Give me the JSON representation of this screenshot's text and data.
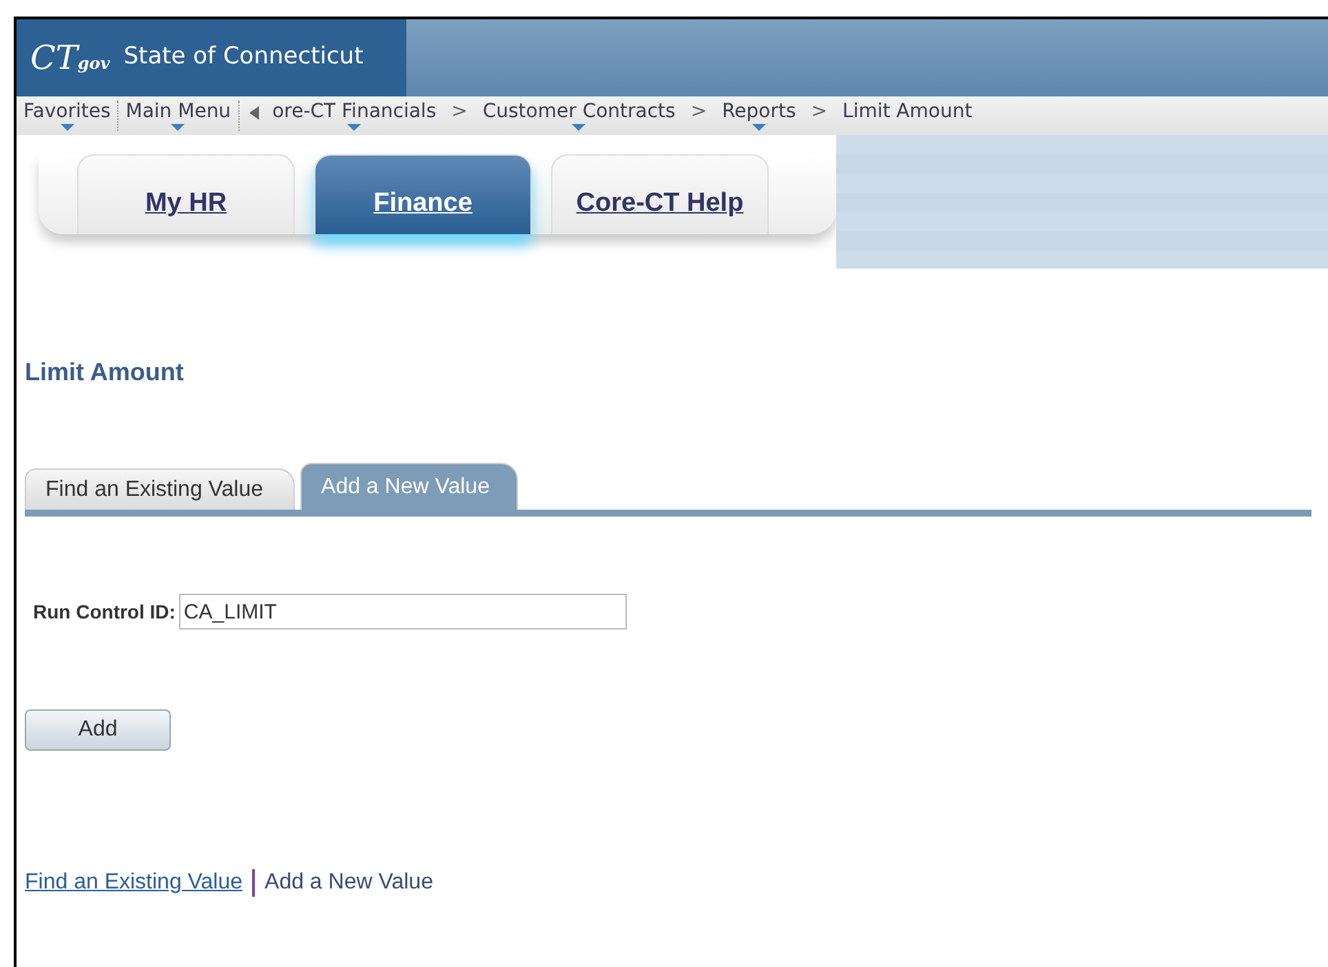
{
  "header": {
    "logo": "CT",
    "logo_suffix": "gov",
    "site_title": "State of Connecticut"
  },
  "breadcrumb": [
    {
      "label": "Favorites",
      "has_menu": true,
      "kind": "menu"
    },
    {
      "label": "Main Menu",
      "has_menu": true,
      "kind": "menu"
    },
    {
      "kind": "back"
    },
    {
      "label": "ore-CT Financials",
      "has_menu": true,
      "kind": "crumb"
    },
    {
      "label": ">",
      "kind": "separator"
    },
    {
      "label": "Customer Contracts",
      "has_menu": true,
      "kind": "crumb"
    },
    {
      "label": ">",
      "kind": "separator"
    },
    {
      "label": "Reports",
      "has_menu": true,
      "kind": "crumb"
    },
    {
      "label": ">",
      "kind": "separator"
    },
    {
      "label": "Limit Amount",
      "has_menu": false,
      "kind": "crumb"
    }
  ],
  "portal_tabs": [
    {
      "label": "My HR",
      "selected": false
    },
    {
      "label": "Finance",
      "selected": true
    },
    {
      "label": "Core-CT Help",
      "selected": false
    }
  ],
  "page_title": "Limit Amount",
  "page_tabs": [
    {
      "label": "Find an Existing Value",
      "selected": false
    },
    {
      "label": "Add a New Value",
      "selected": true
    }
  ],
  "run_control": {
    "label": "Run Control ID:",
    "value": "CA_LIMIT"
  },
  "add_button": "Add",
  "footer_links": [
    {
      "label": "Find an Existing Value",
      "selected": false
    },
    {
      "label": "Add a New Value",
      "selected": true
    }
  ]
}
